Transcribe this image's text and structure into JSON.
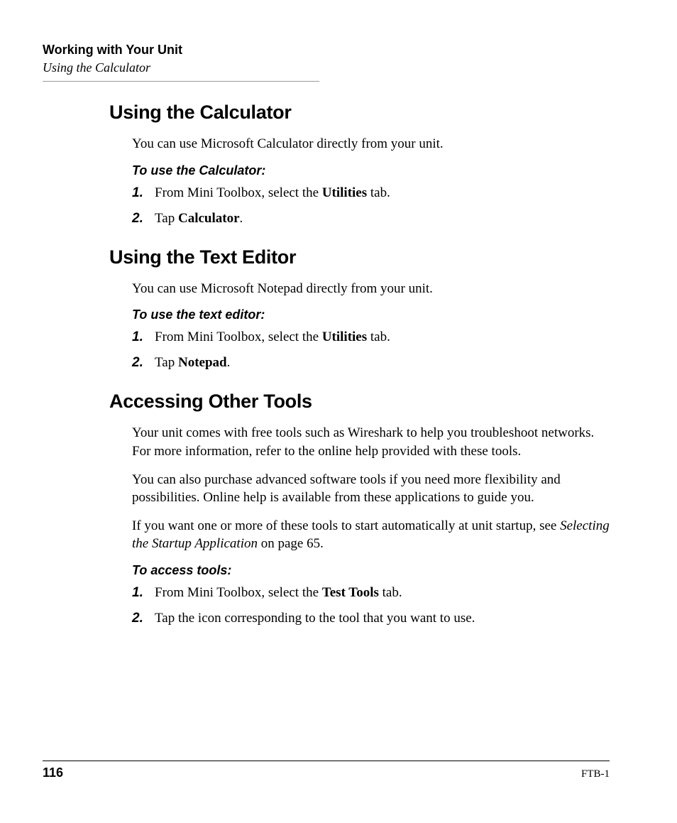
{
  "header": {
    "chapter": "Working with Your Unit",
    "section": "Using the Calculator"
  },
  "sections": {
    "calc": {
      "title": "Using the Calculator",
      "intro": "You can use Microsoft Calculator directly from your unit.",
      "procTitle": "To use the Calculator:",
      "steps": {
        "s1_pre": "From Mini Toolbox, select the ",
        "s1_bold": "Utilities",
        "s1_post": " tab.",
        "s2_pre": "Tap ",
        "s2_bold": "Calculator",
        "s2_post": "."
      }
    },
    "editor": {
      "title": "Using the Text Editor",
      "intro": "You can use Microsoft Notepad directly from your unit.",
      "procTitle": "To use the text editor:",
      "steps": {
        "s1_pre": "From Mini Toolbox, select the ",
        "s1_bold": "Utilities",
        "s1_post": " tab.",
        "s2_pre": "Tap ",
        "s2_bold": "Notepad",
        "s2_post": "."
      }
    },
    "other": {
      "title": "Accessing Other Tools",
      "p1": "Your unit comes with free tools such as Wireshark to help you troubleshoot networks. For more information, refer to the online help provided with these tools.",
      "p2": "You can also purchase advanced software tools if you need more flexibility and possibilities. Online help is available from these applications to guide you.",
      "p3_pre": "If you want one or more of these tools to start automatically at unit startup, see ",
      "p3_italic": "Selecting the Startup Application",
      "p3_post": " on page 65.",
      "procTitle": "To access tools:",
      "steps": {
        "s1_pre": "From Mini Toolbox, select the ",
        "s1_bold": "Test Tools",
        "s1_post": " tab.",
        "s2": "Tap the icon corresponding to the tool that you want to use."
      }
    }
  },
  "nums": {
    "n1": "1.",
    "n2": "2."
  },
  "footer": {
    "page": "116",
    "doc": "FTB-1"
  }
}
